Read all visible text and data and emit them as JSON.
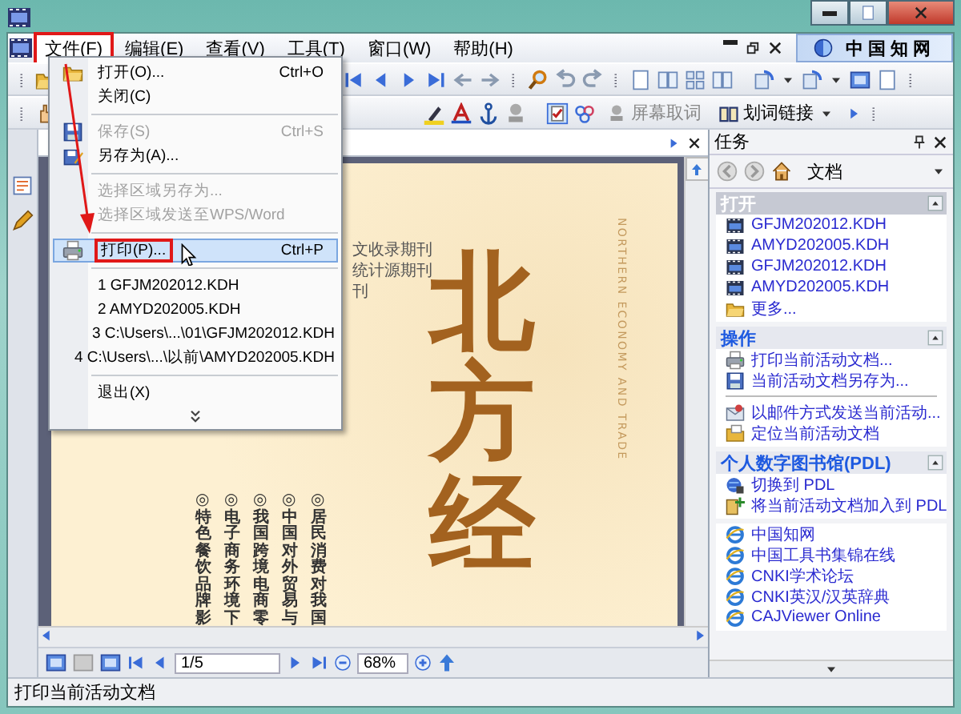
{
  "menu_bar": {
    "items": [
      {
        "label": "文件(F)",
        "selected": true,
        "annotated": true
      },
      {
        "label": "编辑(E)",
        "selected": false,
        "annotated": false
      },
      {
        "label": "查看(V)",
        "selected": false,
        "annotated": false
      },
      {
        "label": "工具(T)",
        "selected": false,
        "annotated": false
      },
      {
        "label": "窗口(W)",
        "selected": false,
        "annotated": false
      },
      {
        "label": "帮助(H)",
        "selected": false,
        "annotated": false
      }
    ],
    "logo": "中国知网"
  },
  "file_menu": {
    "items": [
      {
        "kind": "command",
        "label": "打开(O)...",
        "shortcut": "Ctrl+O",
        "disabled": false,
        "selected": false,
        "annotated": false
      },
      {
        "kind": "command",
        "label": "关闭(C)",
        "disabled": false,
        "selected": false,
        "annotated": false
      },
      {
        "kind": "separator"
      },
      {
        "kind": "command",
        "label": "保存(S)",
        "shortcut": "Ctrl+S",
        "disabled": true,
        "selected": false,
        "annotated": false
      },
      {
        "kind": "command",
        "label": "另存为(A)...",
        "disabled": false,
        "selected": false,
        "annotated": false
      },
      {
        "kind": "separator"
      },
      {
        "kind": "command",
        "label": "选择区域另存为...",
        "disabled": true,
        "selected": false,
        "annotated": false
      },
      {
        "kind": "command",
        "label": "选择区域发送至WPS/Word",
        "disabled": true,
        "selected": false,
        "annotated": false
      },
      {
        "kind": "separator"
      },
      {
        "kind": "command",
        "label": "打印(P)...",
        "shortcut": "Ctrl+P",
        "disabled": false,
        "selected": true,
        "annotated": true
      },
      {
        "kind": "separator"
      },
      {
        "kind": "recent",
        "label": "1 GFJM202012.KDH",
        "disabled": false,
        "selected": false,
        "annotated": false
      },
      {
        "kind": "recent",
        "label": "2 AMYD202005.KDH",
        "disabled": false,
        "selected": false,
        "annotated": false
      },
      {
        "kind": "recent",
        "label": "3 C:\\Users\\...\\01\\GFJM202012.KDH",
        "disabled": false,
        "selected": false,
        "annotated": false
      },
      {
        "kind": "recent",
        "label": "4 C:\\Users\\...\\以前\\AMYD202005.KDH",
        "disabled": false,
        "selected": false,
        "annotated": false
      },
      {
        "kind": "separator"
      },
      {
        "kind": "command",
        "label": "退出(X)",
        "disabled": false,
        "selected": false,
        "annotated": false
      },
      {
        "kind": "more"
      }
    ]
  },
  "toolbar": {
    "buttons": [
      {
        "label": "屏幕取词",
        "disabled": true
      },
      {
        "label": "划词链接",
        "disabled": false
      }
    ]
  },
  "document": {
    "header_lines": [
      "文收录期刊",
      "统计源期刊",
      "刊"
    ],
    "subtitle": "NORTHERN ECONOMY AND TRADE",
    "title": "北方经",
    "articles": [
      "◎特色餐饮品牌影",
      "◎电子商务环境下",
      "◎我国跨境电商零",
      "◎中国对外贸易与",
      "◎居民消费对我国"
    ]
  },
  "task_pane": {
    "title": "任务",
    "location": "文档",
    "sections": [
      {
        "title": "打开",
        "selected": true,
        "items": [
          {
            "kind": "file",
            "label": "GFJM202012.KDH"
          },
          {
            "kind": "file",
            "label": "AMYD202005.KDH"
          },
          {
            "kind": "file",
            "label": "GFJM202012.KDH"
          },
          {
            "kind": "file",
            "label": "AMYD202005.KDH"
          },
          {
            "kind": "folder",
            "label": "更多..."
          }
        ]
      },
      {
        "title": "操作",
        "selected": false,
        "items": [
          {
            "kind": "print",
            "label": "打印当前活动文档..."
          },
          {
            "kind": "save",
            "label": "当前活动文档另存为..."
          },
          {
            "kind": "separator"
          },
          {
            "kind": "mail",
            "label": "以邮件方式发送当前活动..."
          },
          {
            "kind": "locate",
            "label": "定位当前活动文档"
          }
        ]
      },
      {
        "title": "个人数字图书馆(PDL)",
        "selected": false,
        "items": [
          {
            "kind": "switch",
            "label": "切换到 PDL"
          },
          {
            "kind": "add",
            "label": "将当前活动文档加入到 PDL"
          }
        ]
      },
      {
        "items": [
          {
            "kind": "web",
            "label": "中国知网"
          },
          {
            "kind": "web",
            "label": "中国工具书集锦在线"
          },
          {
            "kind": "web",
            "label": "CNKI学术论坛"
          },
          {
            "kind": "web",
            "label": "CNKI英汉/汉英辞典"
          },
          {
            "kind": "web",
            "label": "CAJViewer Online"
          }
        ]
      }
    ]
  },
  "nav_bar": {
    "page": "1/5",
    "zoom": "68%"
  },
  "status_bar": {
    "text": "打印当前活动文档"
  }
}
